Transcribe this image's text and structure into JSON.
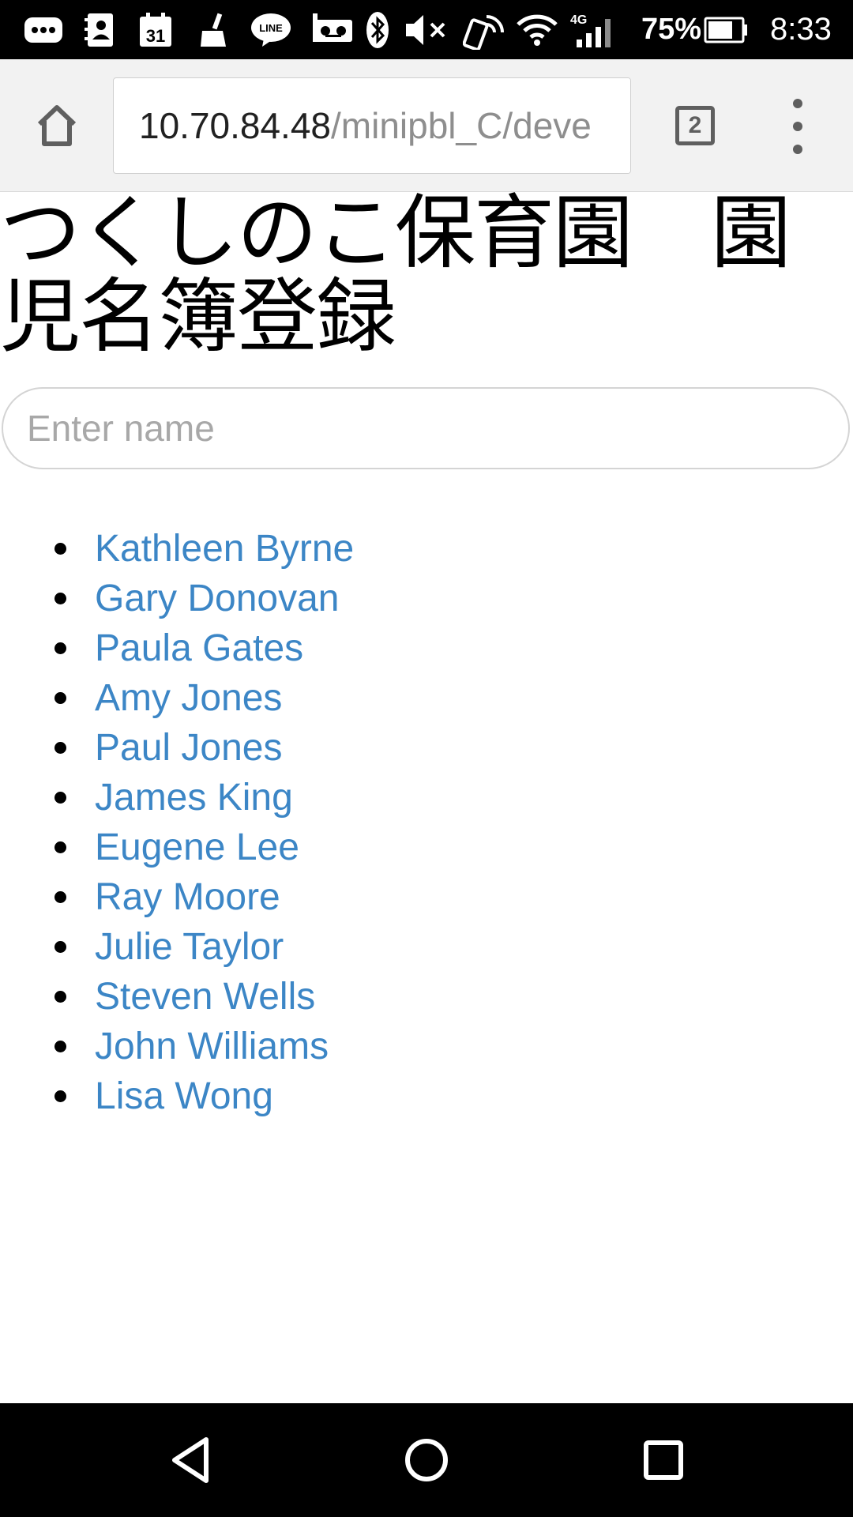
{
  "status_bar": {
    "battery_percent": "75%",
    "battery_level": 0.75,
    "time": "8:33",
    "calendar_day": "31",
    "network_type": "4G",
    "line_app_label": "LINE",
    "icons": [
      "more-notifications-icon",
      "contacts-icon",
      "calendar-icon",
      "cleaner-icon",
      "line-icon",
      "voicemail-icon",
      "bluetooth-icon",
      "mute-icon",
      "nfc-icon",
      "wifi-icon",
      "signal-icon",
      "battery-icon"
    ]
  },
  "browser": {
    "url_host": "10.70.84.48",
    "url_path": "/minipbl_C/deve",
    "tab_count": "2",
    "icons": [
      "home-icon",
      "tabs-icon",
      "more-menu-icon"
    ]
  },
  "page": {
    "title": "つくしのこ保育園　園児名簿登録",
    "search_placeholder": "Enter name",
    "names": [
      "Kathleen Byrne",
      "Gary Donovan",
      "Paula Gates",
      "Amy Jones",
      "Paul Jones",
      "James King",
      "Eugene Lee",
      "Ray Moore",
      "Julie Taylor",
      "Steven Wells",
      "John Williams",
      "Lisa Wong"
    ]
  },
  "colors": {
    "link": "#3c86c6",
    "toolbar": "#f2f2f2",
    "system_bar": "#000000"
  },
  "nav_bar": {
    "icons": [
      "back-icon",
      "home-circle-icon",
      "recents-icon"
    ]
  }
}
